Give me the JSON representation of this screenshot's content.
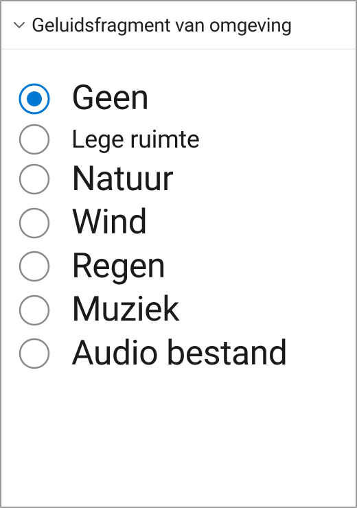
{
  "header": {
    "title": "Geluidsfragment van omgeving"
  },
  "options": [
    {
      "label": "Geen",
      "selected": true,
      "size": "large"
    },
    {
      "label": "Lege ruimte",
      "selected": false,
      "size": "medium"
    },
    {
      "label": "Natuur",
      "selected": false,
      "size": "large"
    },
    {
      "label": "Wind",
      "selected": false,
      "size": "large"
    },
    {
      "label": "Regen",
      "selected": false,
      "size": "large"
    },
    {
      "label": "Muziek",
      "selected": false,
      "size": "large"
    },
    {
      "label": "Audio bestand",
      "selected": false,
      "size": "large"
    }
  ],
  "colors": {
    "accent": "#0078d4",
    "border": "#999",
    "text": "#1a1a1a"
  }
}
